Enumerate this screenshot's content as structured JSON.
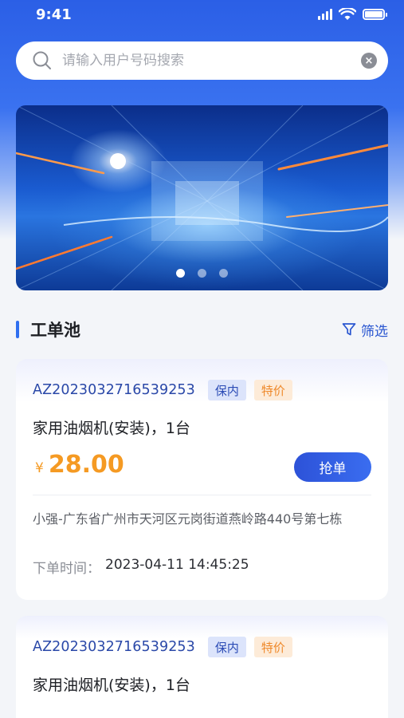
{
  "status_bar": {
    "time": "9:41"
  },
  "search": {
    "placeholder": "请输入用户号码搜索",
    "value": ""
  },
  "banner": {
    "dots": 3,
    "active_dot": 1
  },
  "section": {
    "title": "工单池",
    "filter_label": "筛选"
  },
  "orders": [
    {
      "order_no": "AZ2023032716539253",
      "tags": [
        "保内",
        "特价"
      ],
      "product": "家用油烟机(安装)，1台",
      "price_symbol": "¥",
      "price": "28.00",
      "action_label": "抢单",
      "address": "小强-广东省广州市天河区元岗街道燕岭路440号第七栋",
      "order_time_label": "下单时间：",
      "order_time": "2023-04-11 14:45:25"
    },
    {
      "order_no": "AZ2023032716539253",
      "tags": [
        "保内",
        "特价"
      ],
      "product": "家用油烟机(安装)，1台"
    }
  ],
  "colors": {
    "accent": "#2f6ff0",
    "order_no": "#2a48a8",
    "price": "#f59a23",
    "tag_blue_bg": "#dce4fb",
    "tag_orange_bg": "#fdebd8"
  }
}
